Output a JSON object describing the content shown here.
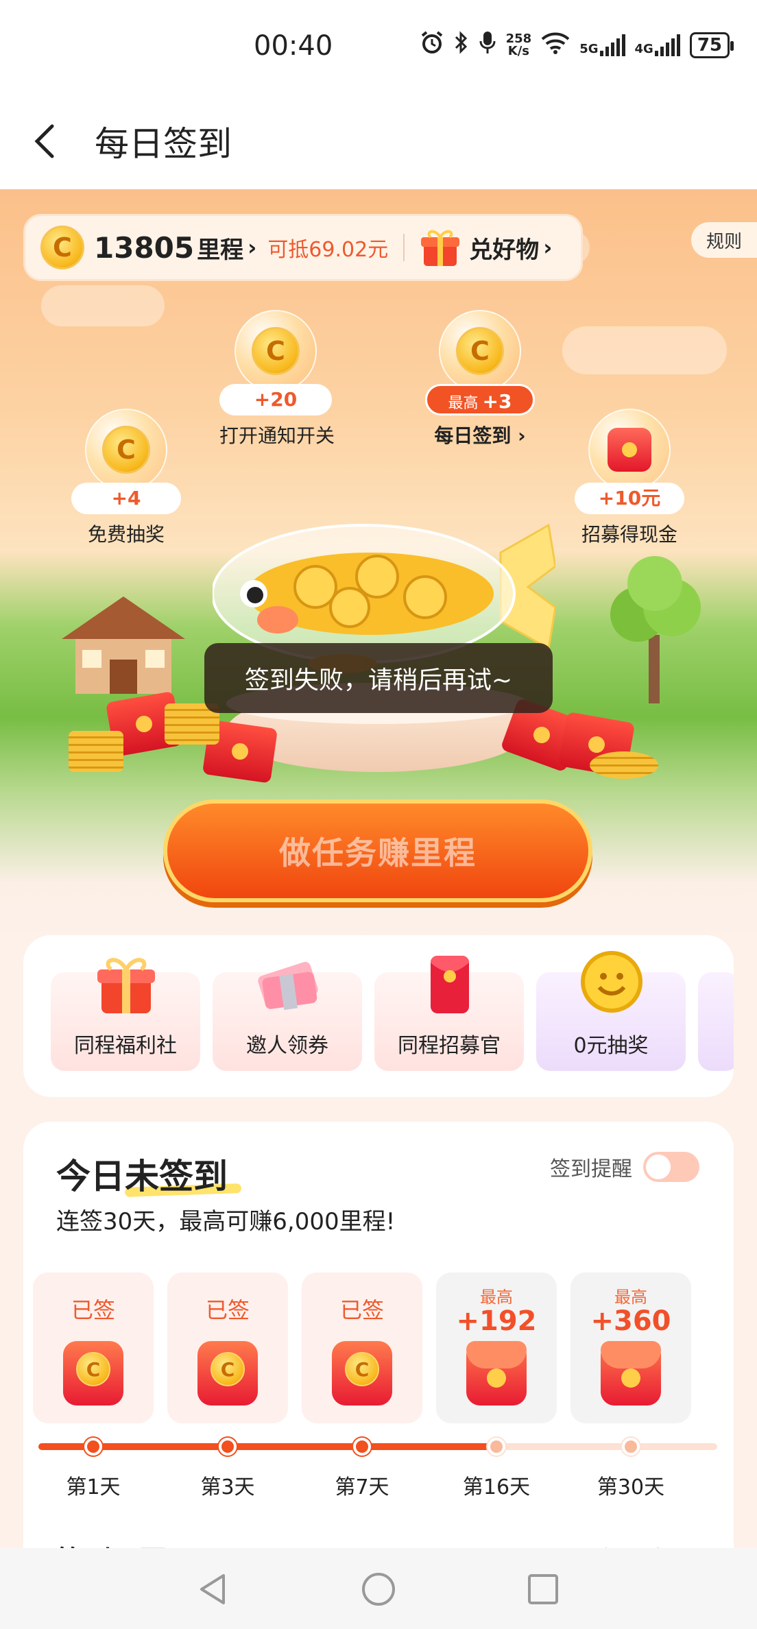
{
  "status_bar": {
    "time": "00:40",
    "net_speed": "258",
    "net_unit": "K/s",
    "sim1": "5G",
    "sim2": "4G",
    "battery": "75"
  },
  "header": {
    "title": "每日签到"
  },
  "points_bar": {
    "points": "13805",
    "unit": "里程",
    "deduct": "可抵69.02元",
    "exchange": "兑好物"
  },
  "rule_label": "规则",
  "tasks": [
    {
      "reward": "+4",
      "label": "免费抽奖"
    },
    {
      "reward": "+20",
      "label": "打开通知开关"
    },
    {
      "reward_prefix": "最高",
      "reward": "+3",
      "label": "每日签到"
    },
    {
      "reward": "+10元",
      "label": "招募得现金"
    }
  ],
  "cta": {
    "label": "做任务赚里程"
  },
  "toast": "签到失败，请稍后再试~",
  "shortcuts": [
    {
      "label": "同程福利社"
    },
    {
      "label": "邀人领券"
    },
    {
      "label": "同程招募官"
    },
    {
      "label": "0元抽奖"
    }
  ],
  "sign_card": {
    "title_pre": "今日",
    "title_hl": "未签到",
    "subtitle": "连签30天，最高可赚6,000里程!",
    "reminder_label": "签到提醒",
    "reminder_on": false,
    "days": [
      {
        "status": "已签",
        "label": "第1天"
      },
      {
        "status": "已签",
        "label": "第3天"
      },
      {
        "status": "已签",
        "label": "第7天"
      },
      {
        "top": "最高",
        "amount": "+192",
        "label": "第16天"
      },
      {
        "top": "最高",
        "amount": "+360",
        "label": "第30天"
      }
    ],
    "progress_fraction": 0.69,
    "peek_title": "签到日历",
    "peek_right": "开启日历提醒"
  },
  "colors": {
    "accent": "#f2501e",
    "coin": "#f8b81c"
  }
}
